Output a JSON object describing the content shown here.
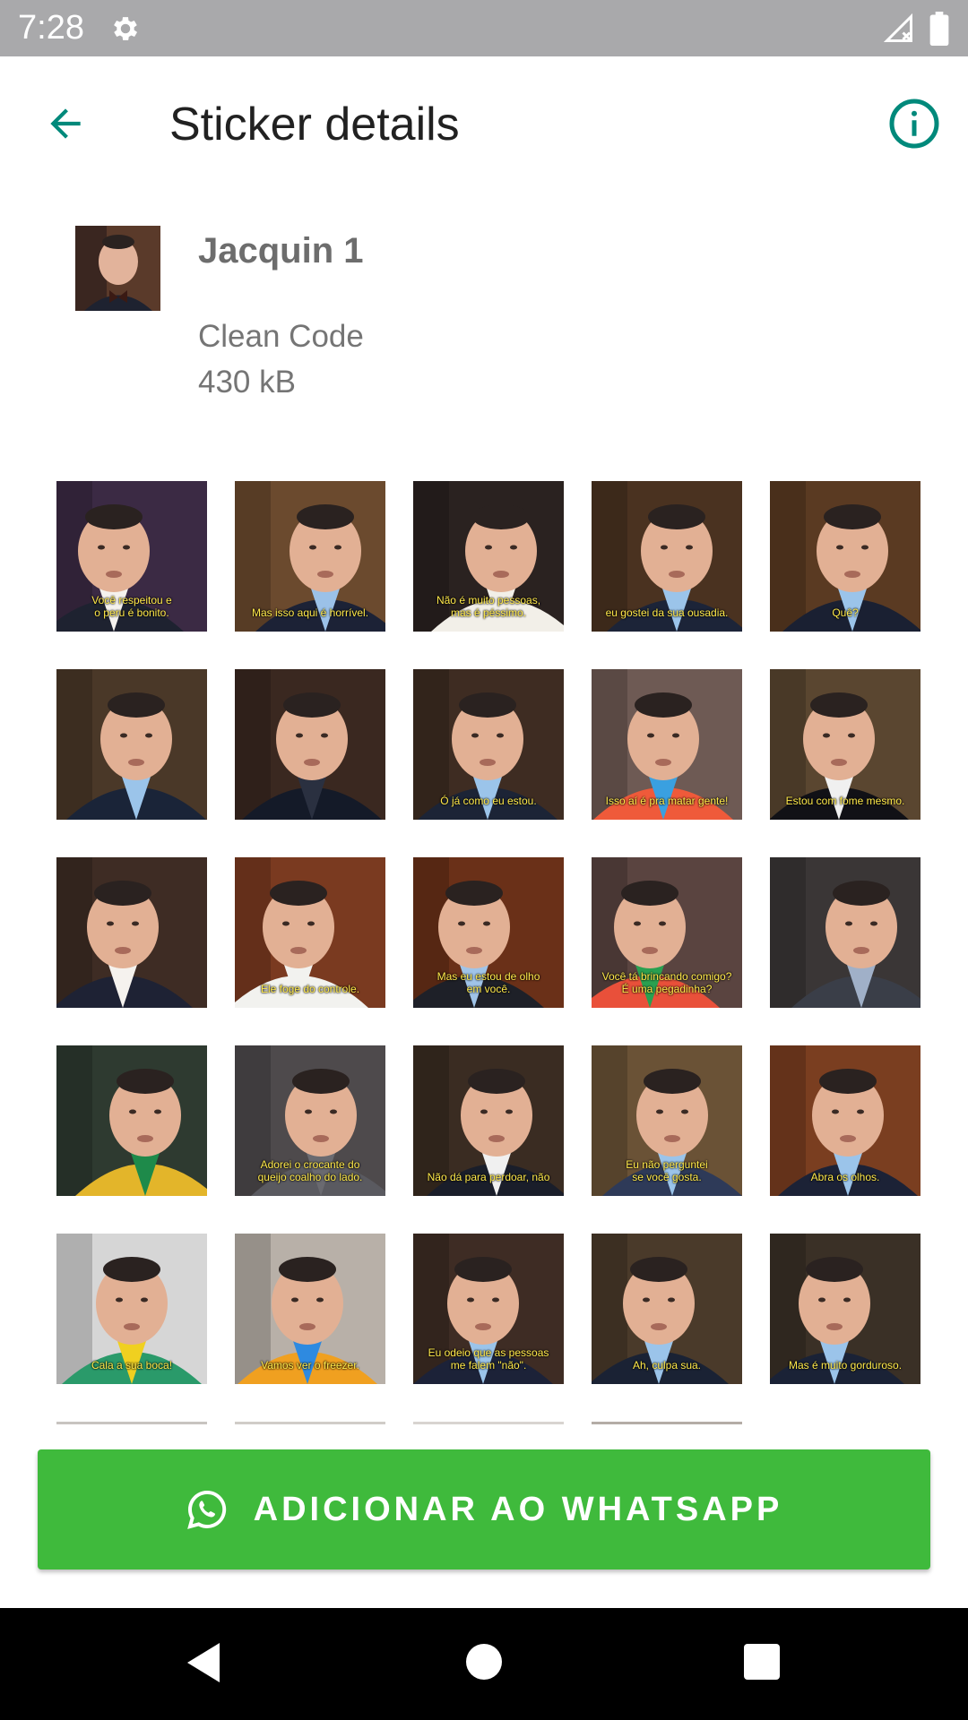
{
  "status_bar": {
    "time": "7:28",
    "icons": [
      "settings-gear-icon",
      "signal-off-icon",
      "battery-icon"
    ]
  },
  "toolbar": {
    "title": "Sticker details",
    "back_icon": "arrow-back-icon",
    "info_icon": "info-circle-icon"
  },
  "pack": {
    "name": "Jacquin 1",
    "publisher": "Clean Code",
    "size": "430 kB"
  },
  "stickers": [
    {
      "caption_1": "Você respeitou e",
      "caption_2": "o peru é bonito."
    },
    {
      "caption_1": "Mas isso aqui é horrível.",
      "caption_2": ""
    },
    {
      "caption_1": "Não é muito pessoas,",
      "caption_2": "mas é péssimo."
    },
    {
      "caption_1": "eu gostei da sua ousadia.",
      "caption_2": ""
    },
    {
      "caption_1": "Quê?",
      "caption_2": ""
    },
    {
      "caption_1": "",
      "caption_2": ""
    },
    {
      "caption_1": "",
      "caption_2": ""
    },
    {
      "caption_1": "Ó já como eu estou.",
      "caption_2": ""
    },
    {
      "caption_1": "Isso aí é pra matar gente!",
      "caption_2": ""
    },
    {
      "caption_1": "Estou com fome mesmo.",
      "caption_2": ""
    },
    {
      "caption_1": "",
      "caption_2": ""
    },
    {
      "caption_1": "Ele foge do controle.",
      "caption_2": ""
    },
    {
      "caption_1": "Mas eu estou de olho",
      "caption_2": "em você."
    },
    {
      "caption_1": "Você tá brincando comigo?",
      "caption_2": "É uma pegadinha?"
    },
    {
      "caption_1": "",
      "caption_2": ""
    },
    {
      "caption_1": "",
      "caption_2": ""
    },
    {
      "caption_1": "Adorei o crocante do",
      "caption_2": "queijo coalho do lado."
    },
    {
      "caption_1": "Não dá para perdoar, não",
      "caption_2": ""
    },
    {
      "caption_1": "Eu não perguntei",
      "caption_2": "se você gosta."
    },
    {
      "caption_1": "Abra os olhos.",
      "caption_2": ""
    },
    {
      "caption_1": "Cala a sua boca!",
      "caption_2": ""
    },
    {
      "caption_1": "Vamos ver o freezer.",
      "caption_2": ""
    },
    {
      "caption_1": "Eu odeio que as pessoas",
      "caption_2": "me falem \"não\"."
    },
    {
      "caption_1": "Ah, culpa sua.",
      "caption_2": ""
    },
    {
      "caption_1": "Mas é muito gorduroso.",
      "caption_2": ""
    }
  ],
  "add_button": {
    "label": "ADICIONAR AO WHATSAPP",
    "icon": "whatsapp-icon"
  },
  "colors": {
    "accent": "#00897b",
    "button": "#3fba3c",
    "status_bar": "#a9a9ab"
  }
}
